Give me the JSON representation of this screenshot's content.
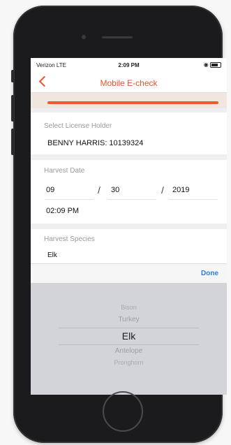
{
  "status_bar": {
    "carrier": "Verizon LTE",
    "time": "2:09 PM"
  },
  "nav": {
    "title": "Mobile E-check"
  },
  "progress": {
    "value": 1.0
  },
  "license_holder": {
    "label": "Select License Holder",
    "value": "BENNY HARRIS: 10139324"
  },
  "harvest_date": {
    "label": "Harvest Date",
    "month": "09",
    "day": "30",
    "year": "2019",
    "separator": "/",
    "time": "02:09 PM"
  },
  "harvest_species": {
    "label": "Harvest Species",
    "value": "Elk"
  },
  "toolbar": {
    "done_label": "Done"
  },
  "picker": {
    "items": [
      "Bison",
      "Turkey",
      "Elk",
      "Antelope",
      "Pronghorn"
    ],
    "selected": "Elk"
  },
  "colors": {
    "accent": "#e8532b",
    "link": "#2f7ae5"
  }
}
